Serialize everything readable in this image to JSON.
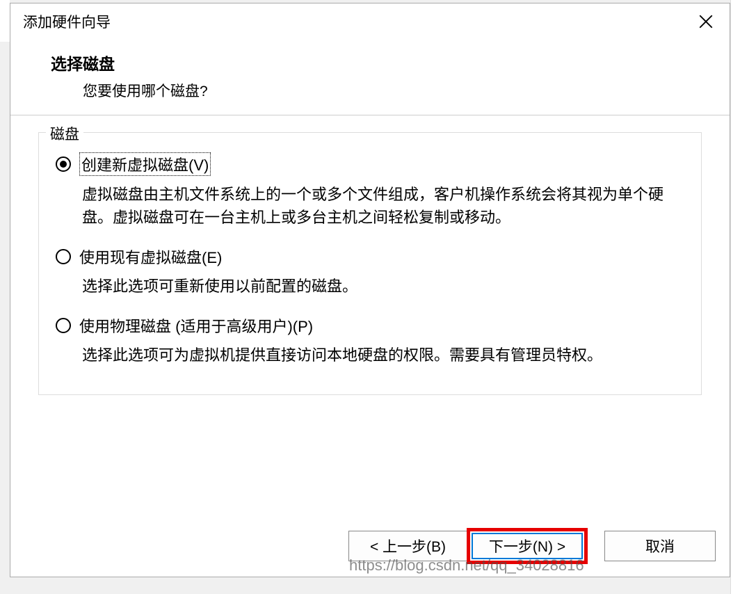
{
  "dialog": {
    "title": "添加硬件向导",
    "page_title": "选择磁盘",
    "page_subtitle": "您要使用哪个磁盘?"
  },
  "group": {
    "label": "磁盘"
  },
  "options": {
    "create": {
      "label": "创建新虚拟磁盘(V)",
      "desc": "虚拟磁盘由主机文件系统上的一个或多个文件组成，客户机操作系统会将其视为单个硬盘。虚拟磁盘可在一台主机上或多台主机之间轻松复制或移动。"
    },
    "existing": {
      "label": "使用现有虚拟磁盘(E)",
      "desc": "选择此选项可重新使用以前配置的磁盘。"
    },
    "physical": {
      "label": "使用物理磁盘 (适用于高级用户)(P)",
      "desc": "选择此选项可为虚拟机提供直接访问本地硬盘的权限。需要具有管理员特权。"
    }
  },
  "buttons": {
    "back": "< 上一步(B)",
    "next": "下一步(N) >",
    "cancel": "取消"
  },
  "watermark": "https://blog.csdn.net/qq_34028816"
}
